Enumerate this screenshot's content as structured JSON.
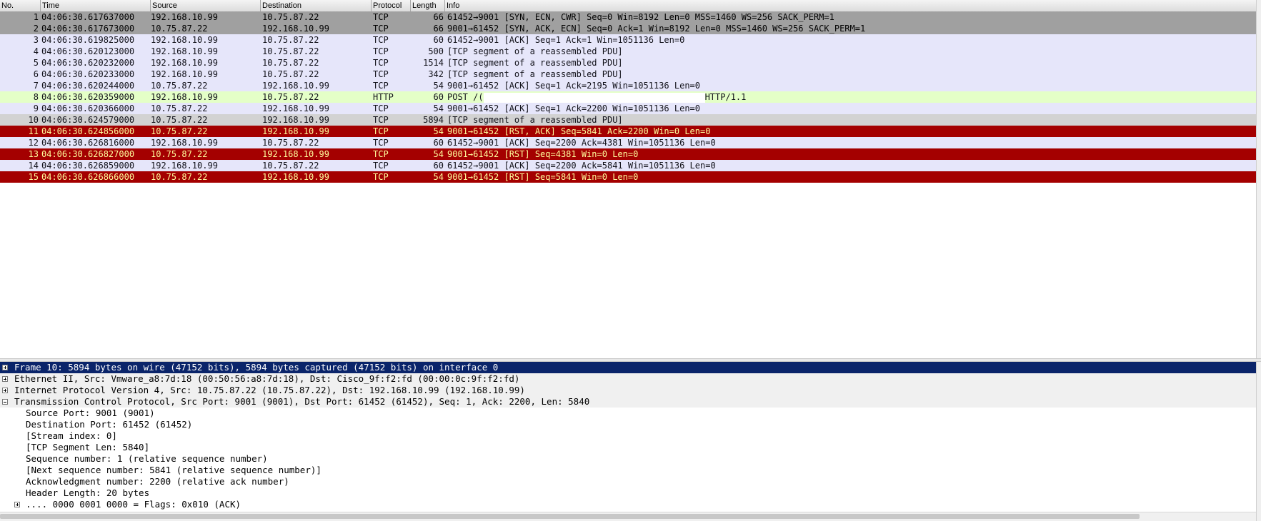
{
  "columns": {
    "no": "No.",
    "time": "Time",
    "source": "Source",
    "destination": "Destination",
    "protocol": "Protocol",
    "length": "Length",
    "info": "Info"
  },
  "packets": [
    {
      "no": "1",
      "time": "04:06:30.617637000",
      "source": "192.168.10.99",
      "destination": "10.75.87.22",
      "protocol": "TCP",
      "length": "66",
      "info": "61452→9001 [SYN, ECN, CWR] Seq=0 Win=8192 Len=0 MSS=1460 WS=256 SACK_PERM=1",
      "style": "syn"
    },
    {
      "no": "2",
      "time": "04:06:30.617673000",
      "source": "10.75.87.22",
      "destination": "192.168.10.99",
      "protocol": "TCP",
      "length": "66",
      "info": "9001→61452 [SYN, ACK, ECN] Seq=0 Ack=1 Win=8192 Len=0 MSS=1460 WS=256 SACK_PERM=1",
      "style": "syn"
    },
    {
      "no": "3",
      "time": "04:06:30.619825000",
      "source": "192.168.10.99",
      "destination": "10.75.87.22",
      "protocol": "TCP",
      "length": "60",
      "info": "61452→9001 [ACK] Seq=1 Ack=1 Win=1051136 Len=0",
      "style": "tcp"
    },
    {
      "no": "4",
      "time": "04:06:30.620123000",
      "source": "192.168.10.99",
      "destination": "10.75.87.22",
      "protocol": "TCP",
      "length": "500",
      "info": "[TCP segment of a reassembled PDU]",
      "style": "tcp"
    },
    {
      "no": "5",
      "time": "04:06:30.620232000",
      "source": "192.168.10.99",
      "destination": "10.75.87.22",
      "protocol": "TCP",
      "length": "1514",
      "info": "[TCP segment of a reassembled PDU]",
      "style": "tcp"
    },
    {
      "no": "6",
      "time": "04:06:30.620233000",
      "source": "192.168.10.99",
      "destination": "10.75.87.22",
      "protocol": "TCP",
      "length": "342",
      "info": "[TCP segment of a reassembled PDU]",
      "style": "tcp"
    },
    {
      "no": "7",
      "time": "04:06:30.620244000",
      "source": "10.75.87.22",
      "destination": "192.168.10.99",
      "protocol": "TCP",
      "length": "54",
      "info": "9001→61452 [ACK] Seq=1 Ack=2195 Win=1051136 Len=0",
      "style": "tcp"
    },
    {
      "no": "8",
      "time": "04:06:30.620359000",
      "source": "192.168.10.99",
      "destination": "10.75.87.22",
      "protocol": "HTTP",
      "length": "60",
      "info": "POST /(",
      "info_tail": "HTTP/1.1",
      "style": "http"
    },
    {
      "no": "9",
      "time": "04:06:30.620366000",
      "source": "10.75.87.22",
      "destination": "192.168.10.99",
      "protocol": "TCP",
      "length": "54",
      "info": "9001→61452 [ACK] Seq=1 Ack=2200 Win=1051136 Len=0",
      "style": "tcp"
    },
    {
      "no": "10",
      "time": "04:06:30.624579000",
      "source": "10.75.87.22",
      "destination": "192.168.10.99",
      "protocol": "TCP",
      "length": "5894",
      "info": "[TCP segment of a reassembled PDU]",
      "style": "reassm"
    },
    {
      "no": "11",
      "time": "04:06:30.624856000",
      "source": "10.75.87.22",
      "destination": "192.168.10.99",
      "protocol": "TCP",
      "length": "54",
      "info": "9001→61452 [RST, ACK] Seq=5841 Ack=2200 Win=0 Len=0",
      "style": "rst"
    },
    {
      "no": "12",
      "time": "04:06:30.626816000",
      "source": "192.168.10.99",
      "destination": "10.75.87.22",
      "protocol": "TCP",
      "length": "60",
      "info": "61452→9001 [ACK] Seq=2200 Ack=4381 Win=1051136 Len=0",
      "style": "tcp"
    },
    {
      "no": "13",
      "time": "04:06:30.626827000",
      "source": "10.75.87.22",
      "destination": "192.168.10.99",
      "protocol": "TCP",
      "length": "54",
      "info": "9001→61452 [RST] Seq=4381 Win=0 Len=0",
      "style": "rst"
    },
    {
      "no": "14",
      "time": "04:06:30.626859000",
      "source": "192.168.10.99",
      "destination": "10.75.87.22",
      "protocol": "TCP",
      "length": "60",
      "info": "61452→9001 [ACK] Seq=2200 Ack=5841 Win=1051136 Len=0",
      "style": "tcp"
    },
    {
      "no": "15",
      "time": "04:06:30.626866000",
      "source": "10.75.87.22",
      "destination": "192.168.10.99",
      "protocol": "TCP",
      "length": "54",
      "info": "9001→61452 [RST] Seq=5841 Win=0 Len=0",
      "style": "rst"
    }
  ],
  "details": {
    "frame": "Frame 10: 5894 bytes on wire (47152 bits), 5894 bytes captured (47152 bits) on interface 0",
    "ethernet": "Ethernet II, Src: Vmware_a8:7d:18 (00:50:56:a8:7d:18), Dst: Cisco_9f:f2:fd (00:00:0c:9f:f2:fd)",
    "ip": "Internet Protocol Version 4, Src: 10.75.87.22 (10.75.87.22), Dst: 192.168.10.99 (192.168.10.99)",
    "tcp": "Transmission Control Protocol, Src Port: 9001 (9001), Dst Port: 61452 (61452), Seq: 1, Ack: 2200, Len: 5840",
    "tcp_fields": [
      "Source Port: 9001 (9001)",
      "Destination Port: 61452 (61452)",
      "[Stream index: 0]",
      "[TCP Segment Len: 5840]",
      "Sequence number: 1    (relative sequence number)",
      "[Next sequence number: 5841    (relative sequence number)]",
      "Acknowledgment number: 2200    (relative ack number)",
      "Header Length: 20 bytes"
    ],
    "flags": ".... 0000 0001 0000 = Flags: 0x010 (ACK)"
  }
}
